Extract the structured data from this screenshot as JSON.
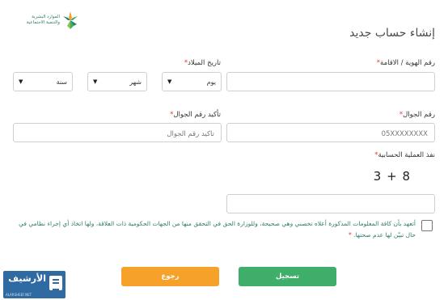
{
  "logo": {
    "line1": "الموارد البشرية",
    "line2": "والتنمية الاجتماعية"
  },
  "page_title": "إنشاء حساب جديد",
  "form": {
    "id_label": "رقم الهوية / الاقامة",
    "dob_label": "تاريخ الميلاد",
    "dob": {
      "day": "يوم",
      "month": "شهر",
      "year": "سنة"
    },
    "mobile_label": "رقم الجوال",
    "mobile_placeholder": "05XXXXXXXX",
    "mobile_confirm_label": "تأكيد رقم الجوال",
    "mobile_confirm_placeholder": "تأكيد رقم الجوال",
    "captcha_label": "نفذ العملية الحسابية",
    "captcha_expression": "3 + 8",
    "required_mark": "*",
    "terms_text": "أتعهد بأن كافة المعلومات المذكورة أعلاه تخصني وهي صحيحة، وللوزارة الحق في التحقق منها من الجهات الحكومية ذات العلاقة، ولها اتخاذ أي إجراء نظامي في حال تبيّن لها عدم صحتها."
  },
  "buttons": {
    "register": "تسجيل",
    "back": "رجوع"
  },
  "badge": {
    "title": "الأرشيف",
    "subtitle": "ALARSHEEF.NET"
  },
  "colors": {
    "green": "#3fae6b",
    "orange": "#f5a12a",
    "teal": "#2e7d6b",
    "badge": "#2f6aa3"
  }
}
